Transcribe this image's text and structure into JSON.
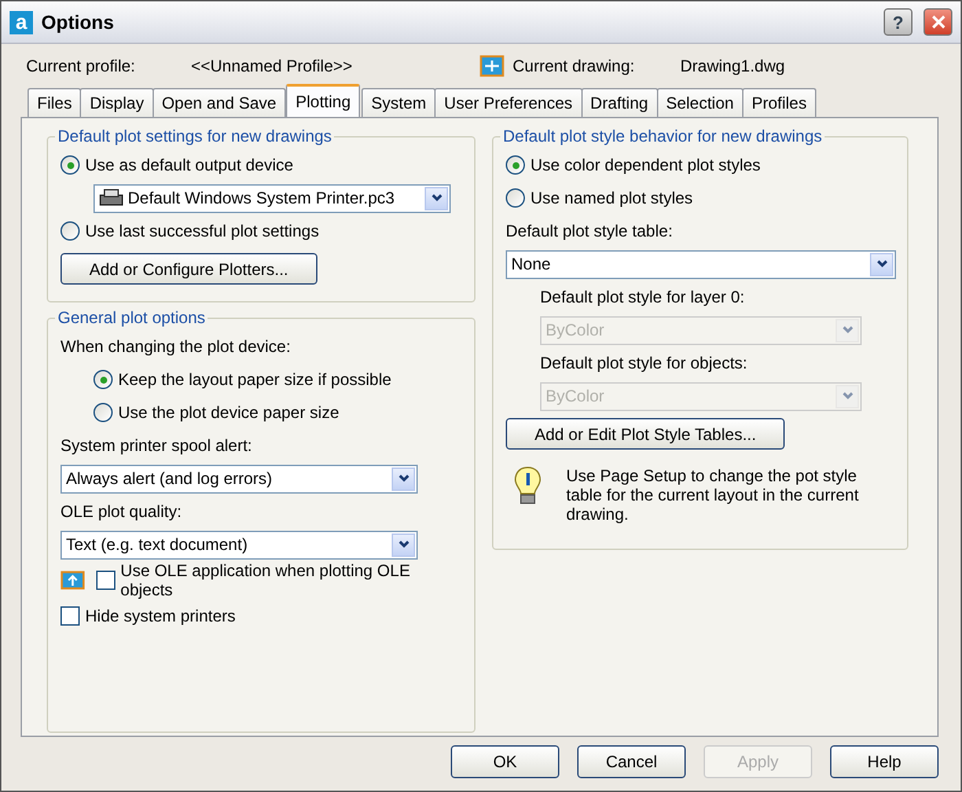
{
  "window": {
    "app_letter": "a",
    "title": "Options",
    "help_glyph": "?"
  },
  "profile": {
    "label": "Current profile:",
    "value": "<<Unnamed Profile>>",
    "drawing_label": "Current drawing:",
    "drawing_value": "Drawing1.dwg"
  },
  "tabs": [
    {
      "label": "Files",
      "selected": false
    },
    {
      "label": "Display",
      "selected": false
    },
    {
      "label": "Open and Save",
      "selected": false
    },
    {
      "label": "Plotting",
      "selected": true
    },
    {
      "label": "System",
      "selected": false
    },
    {
      "label": "User Preferences",
      "selected": false
    },
    {
      "label": "Drafting",
      "selected": false
    },
    {
      "label": "Selection",
      "selected": false
    },
    {
      "label": "Profiles",
      "selected": false
    }
  ],
  "left_groups": [
    {
      "title": "Default plot settings for new drawings",
      "items": [
        {
          "kind": "radio",
          "label": "Use as default output device",
          "selected": true,
          "children": [
            {
              "kind": "device-select",
              "value": "Default Windows System Printer.pc3",
              "disabled": false
            }
          ]
        },
        {
          "kind": "radio",
          "label": "Use last successful plot settings",
          "selected": false
        },
        {
          "kind": "button",
          "label": "Add or Configure Plotters..."
        }
      ]
    },
    {
      "title": "General plot options",
      "items": [
        {
          "kind": "label",
          "label": "When changing the plot device:",
          "children": [
            {
              "kind": "radio",
              "label": "Keep the layout paper size if possible",
              "selected": true
            },
            {
              "kind": "radio",
              "label": "Use the plot device paper size",
              "selected": false
            }
          ]
        },
        {
          "kind": "label",
          "label": "System printer spool alert:"
        },
        {
          "kind": "select",
          "value": "Always alert (and log errors)",
          "disabled": false
        },
        {
          "kind": "label",
          "label": "OLE plot quality:"
        },
        {
          "kind": "select",
          "value": "Text (e.g. text document)",
          "disabled": false
        },
        {
          "kind": "ole-checkbox",
          "label": "Use OLE application when plotting OLE objects",
          "checked": false
        },
        {
          "kind": "checkbox",
          "label": "Hide system printers",
          "checked": false
        }
      ]
    }
  ],
  "right_group": {
    "title": "Default plot style behavior for new drawings",
    "items": [
      {
        "kind": "radio",
        "label": "Use color dependent plot styles",
        "selected": true
      },
      {
        "kind": "radio",
        "label": "Use named plot styles",
        "selected": false
      },
      {
        "kind": "label",
        "label": "Default plot style table:"
      },
      {
        "kind": "select",
        "value": "None",
        "disabled": false
      },
      {
        "kind": "group",
        "children": [
          {
            "kind": "label",
            "label": "Default plot style for layer 0:"
          },
          {
            "kind": "select",
            "value": "ByColor",
            "disabled": true
          },
          {
            "kind": "label",
            "label": "Default plot style for objects:"
          },
          {
            "kind": "select",
            "value": "ByColor",
            "disabled": true
          }
        ]
      },
      {
        "kind": "button",
        "label": "Add or Edit Plot Style Tables..."
      },
      {
        "kind": "note",
        "label": "Use Page Setup to change the pot style table for the current layout in the current drawing."
      }
    ]
  },
  "buttons": [
    {
      "label": "OK",
      "disabled": false
    },
    {
      "label": "Cancel",
      "disabled": false
    },
    {
      "label": "Apply",
      "disabled": true
    },
    {
      "label": "Help",
      "disabled": false
    }
  ]
}
